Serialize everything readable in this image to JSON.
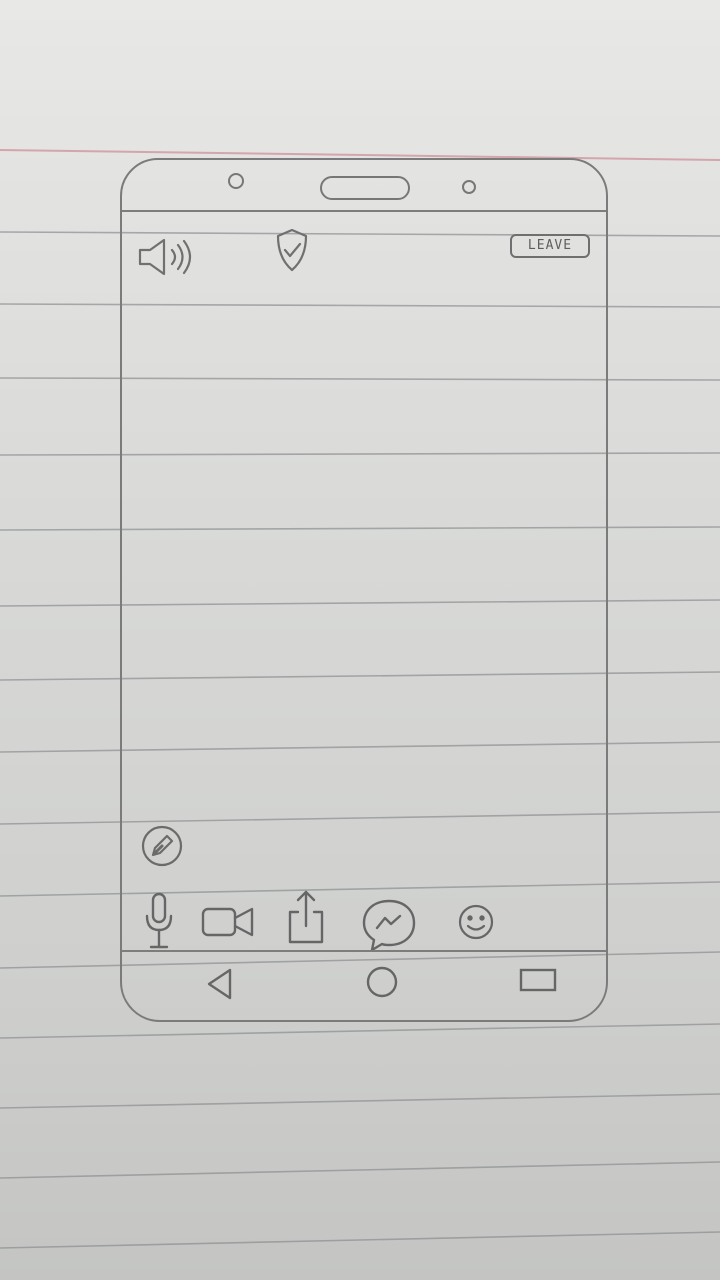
{
  "top_bar": {
    "leave_label": "LEAVE",
    "icons": [
      "speaker-icon",
      "shield-check-icon"
    ]
  },
  "bottom_toolbar": {
    "icons": [
      "microphone-icon",
      "video-camera-icon",
      "share-icon",
      "messenger-icon",
      "emoji-icon"
    ]
  },
  "floating_action": {
    "icon": "pencil-icon"
  },
  "nav_bar": {
    "icons": [
      "back-triangle-icon",
      "home-circle-icon",
      "recents-square-icon"
    ]
  },
  "colors": {
    "pencil_stroke": "#6f6f6f",
    "paper": "#d9dad8",
    "rule_line": "#8f9194",
    "margin_line": "#d9a9b0"
  }
}
